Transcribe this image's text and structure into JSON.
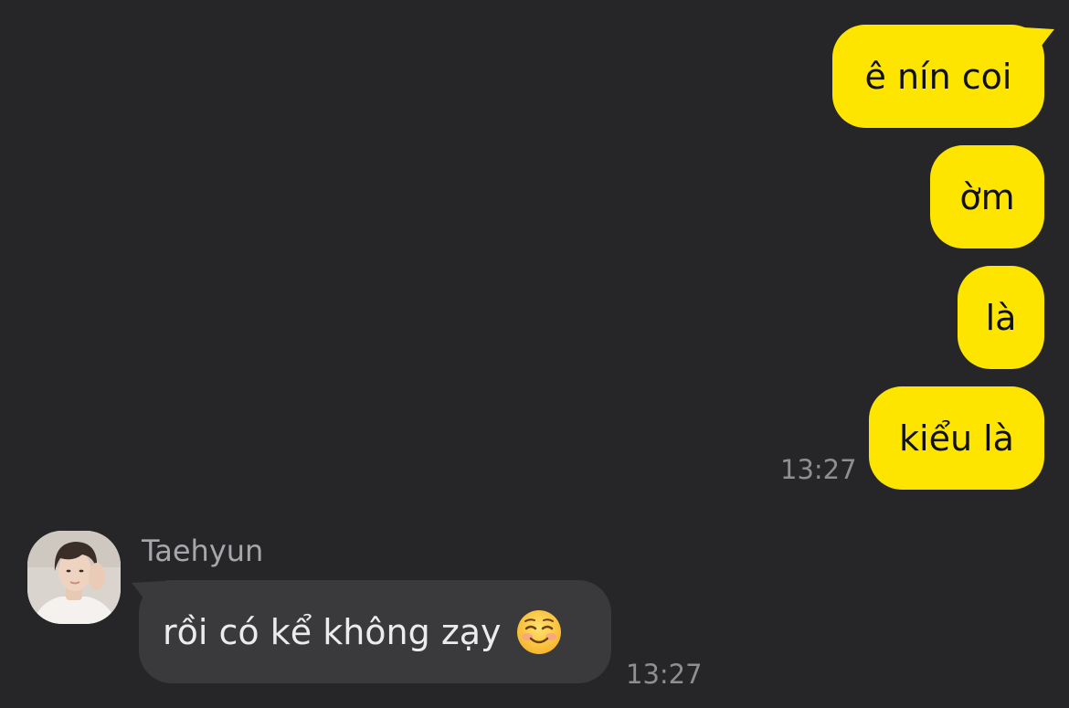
{
  "colors": {
    "background": "#262628",
    "outgoing_bubble": "#FEE500",
    "incoming_bubble": "#3A3A3C",
    "timestamp": "#8E8E93"
  },
  "outgoing": {
    "messages": [
      {
        "text": "ê nín coi"
      },
      {
        "text": "ờm"
      },
      {
        "text": "là"
      },
      {
        "text": "kiểu là"
      }
    ],
    "time": "13:27"
  },
  "incoming": {
    "sender": "Taehyun",
    "avatar_icon": "avatar-photo",
    "message": "rồi có kể không zạy",
    "emoji_icon": "smiling-face-emoji",
    "time": "13:27"
  }
}
